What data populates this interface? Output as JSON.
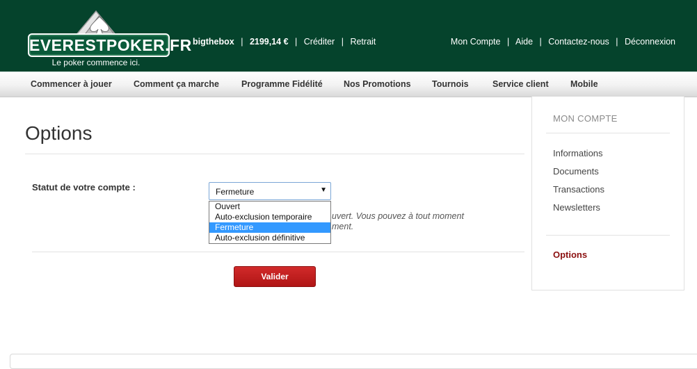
{
  "header": {
    "logo_text": "EVERESTPOKER.FR",
    "logo_tagline": "Le poker commence ici.",
    "username": "bigthebox",
    "balance": "2199,14 €",
    "credit_label": "Créditer",
    "withdraw_label": "Retrait",
    "links": [
      "Mon Compte",
      "Aide",
      "Contactez-nous",
      "Déconnexion"
    ],
    "separator": "|",
    "bg_color": "#05432c"
  },
  "nav": {
    "items": [
      "Commencer à jouer",
      "Comment ça marche",
      "Programme Fidélité",
      "Nos Promotions",
      "Tournois",
      "Service client",
      "Mobile"
    ]
  },
  "main": {
    "title": "Options",
    "status_label": "Statut de votre compte :",
    "select_value": "Fermeture",
    "options": [
      "Ouvert",
      "Auto-exclusion temporaire",
      "Fermeture",
      "Auto-exclusion définitive"
    ],
    "selected_index": 2,
    "desc_line1": "uvert. Vous pouvez à tout moment",
    "desc_line2": "ment.",
    "submit_label": "Valider",
    "button_color": "#c21d1d"
  },
  "sidebar": {
    "title": "MON COMPTE",
    "items": [
      "Informations",
      "Documents",
      "Transactions",
      "Newsletters"
    ],
    "active": "Options",
    "active_color": "#8b1010"
  }
}
